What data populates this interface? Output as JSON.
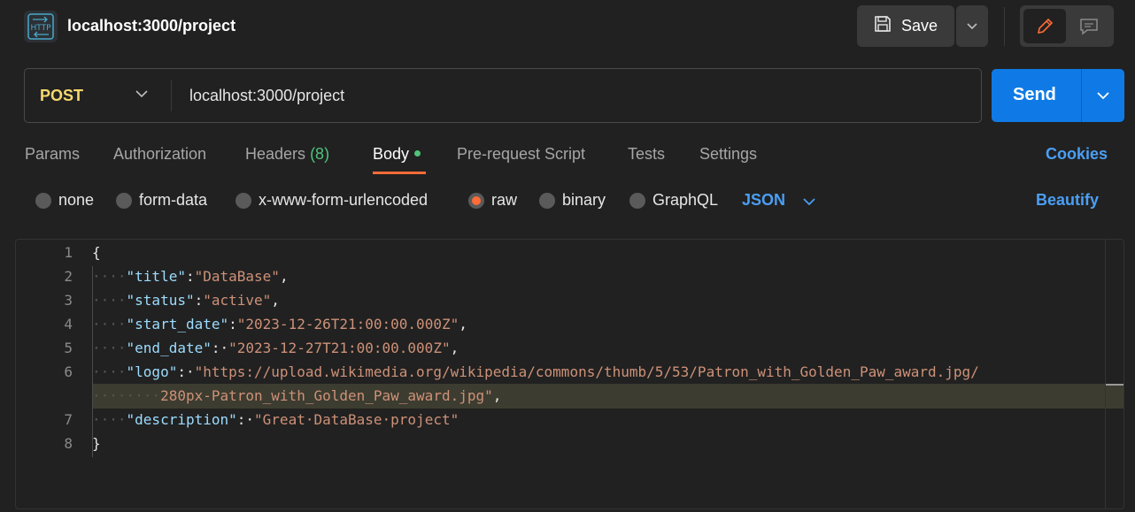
{
  "header": {
    "badge_text": "HTTP",
    "title": "localhost:3000/project",
    "save_label": "Save"
  },
  "request": {
    "method": "POST",
    "url": "localhost:3000/project",
    "send_label": "Send"
  },
  "tabs": [
    {
      "label": "Params"
    },
    {
      "label": "Authorization"
    },
    {
      "label": "Headers",
      "count": "(8)"
    },
    {
      "label": "Body",
      "active": true
    },
    {
      "label": "Pre-request Script"
    },
    {
      "label": "Tests"
    },
    {
      "label": "Settings"
    }
  ],
  "cookies_label": "Cookies",
  "body_types": [
    {
      "label": "none"
    },
    {
      "label": "form-data"
    },
    {
      "label": "x-www-form-urlencoded"
    },
    {
      "label": "raw",
      "selected": true
    },
    {
      "label": "binary"
    },
    {
      "label": "GraphQL"
    }
  ],
  "format": "JSON",
  "beautify_label": "Beautify",
  "editor": {
    "line_numbers": [
      "1",
      "2",
      "3",
      "4",
      "5",
      "6",
      "7",
      "8"
    ],
    "lines": [
      {
        "open": "{"
      },
      {
        "key": "\"title\"",
        "sep": ":",
        "value": "\"DataBase\"",
        "end": ","
      },
      {
        "key": "\"status\"",
        "sep": ":",
        "value": "\"active\"",
        "end": ","
      },
      {
        "key": "\"start_date\"",
        "sep": ":",
        "value": "\"2023-12-26T21:00:00.000Z\"",
        "end": ","
      },
      {
        "key": "\"end_date\"",
        "sep": ":·",
        "value": "\"2023-12-27T21:00:00.000Z\"",
        "end": ","
      },
      {
        "key": "\"logo\"",
        "sep": ":·",
        "value": "\"https://upload.wikimedia.org/wikipedia/commons/thumb/5/53/Patron_with_Golden_Paw_award.jpg/",
        "cont": "280px-Patron_with_Golden_Paw_award.jpg\"",
        "end": ","
      },
      {
        "key": "\"description\"",
        "sep": ":·",
        "value": "\"Great·DataBase·project\""
      },
      {
        "open": "}"
      }
    ]
  },
  "colors": {
    "accent": "#ff6c37",
    "send": "#0f7ae5",
    "link": "#4a9ff5",
    "method": "#f5d76e",
    "json_key": "#9cdcfe",
    "json_string": "#ce9178"
  }
}
